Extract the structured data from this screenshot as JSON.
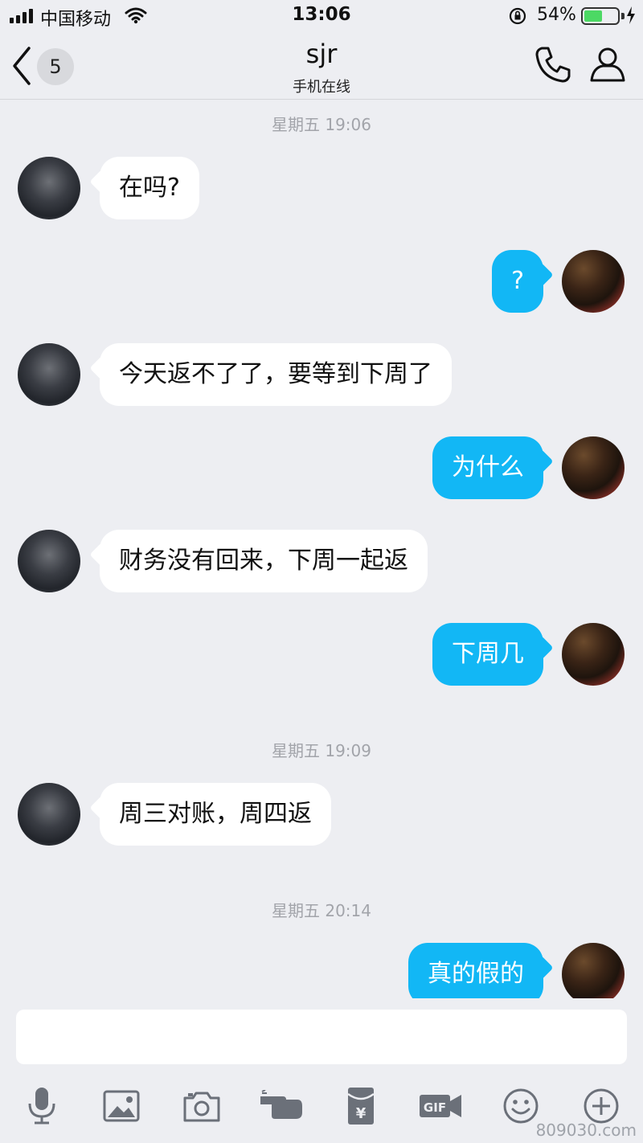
{
  "status_bar": {
    "carrier": "中国移动",
    "time": "13:06",
    "battery_pct": "54%",
    "battery_level": 0.54
  },
  "nav": {
    "back_count": "5",
    "title": "sjr",
    "subtitle": "手机在线"
  },
  "timestamps": [
    "星期五 19:06",
    "星期五 19:09",
    "星期五 20:14"
  ],
  "messages": [
    {
      "direction": "in",
      "text": "在吗?"
    },
    {
      "direction": "out",
      "text": "?"
    },
    {
      "direction": "in",
      "text": "今天返不了了，要等到下周了"
    },
    {
      "direction": "out",
      "text": "为什么"
    },
    {
      "direction": "in",
      "text": "财务没有回来，下周一起返"
    },
    {
      "direction": "out",
      "text": "下周几"
    },
    {
      "direction": "in",
      "text": "周三对账，周四返"
    },
    {
      "direction": "out",
      "text": "真的假的"
    }
  ],
  "toolbar": {
    "icons": [
      "microphone-icon",
      "image-icon",
      "camera-icon",
      "poke-hand-icon",
      "red-packet-icon",
      "gif-icon",
      "emoji-icon",
      "plus-icon"
    ],
    "gif_label": "GIF",
    "red_packet_label": "¥"
  },
  "watermark": "809030.com",
  "colors": {
    "accent": "#12b7f5",
    "background": "#edeef2",
    "incoming_bubble": "#ffffff"
  }
}
